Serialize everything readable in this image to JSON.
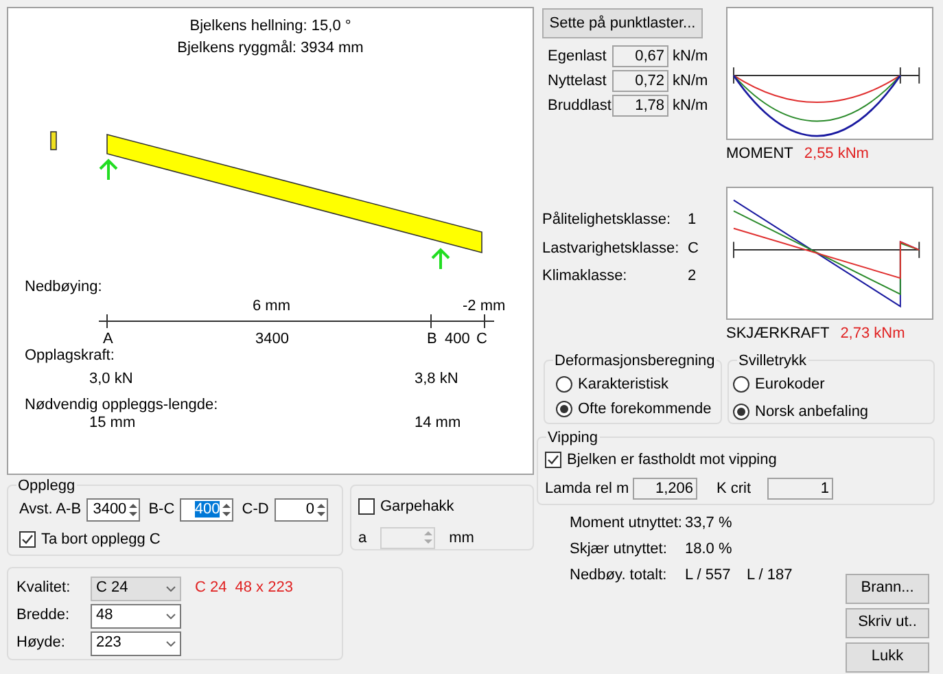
{
  "beam_view": {
    "slope": "Bjelkens hellning: 15,0 °",
    "ridge": "Bjelkens ryggmål: 3934 mm",
    "deflection_label": "Nedbøying:",
    "deflections": [
      "6 mm",
      "-2 mm"
    ],
    "supports": [
      "A",
      "B",
      "C"
    ],
    "spans": [
      "3400",
      "400"
    ],
    "reaction_label": "Opplagskraft:",
    "reactions": [
      "3,0 kN",
      "3,8 kN"
    ],
    "bearing_label": "Nødvendig oppleggs-lengde:",
    "bearing_lengths": [
      "15 mm",
      "14 mm"
    ]
  },
  "point_load_button": "Sette på punktlaster...",
  "loads": [
    {
      "label": "Egenlast",
      "value": "0,67",
      "unit": "kN/m"
    },
    {
      "label": "Nyttelast",
      "value": "0,72",
      "unit": "kN/m"
    },
    {
      "label": "Bruddlast",
      "value": "1,78",
      "unit": "kN/m"
    }
  ],
  "moment": {
    "label": "MOMENT",
    "value": "2,55 kNm"
  },
  "shear": {
    "label": "SKJÆRKRAFT",
    "value": "2,73 kNm"
  },
  "classes": [
    {
      "label": "Pålitelighetsklasse:",
      "value": "1"
    },
    {
      "label": "Lastvarighetsklasse:",
      "value": "C"
    },
    {
      "label": "Klimaklasse:",
      "value": "2"
    }
  ],
  "deformation": {
    "title": "Deformasjonsberegning",
    "options": [
      {
        "label": "Karakteristisk",
        "selected": false
      },
      {
        "label": "Ofte forekommende",
        "selected": true
      }
    ]
  },
  "sill": {
    "title": "Svilletrykk",
    "options": [
      {
        "label": "Eurokoder",
        "selected": false
      },
      {
        "label": "Norsk anbefaling",
        "selected": true
      }
    ]
  },
  "tipping": {
    "title": "Vipping",
    "checkbox": {
      "label": "Bjelken er fastholdt mot vipping",
      "checked": true
    },
    "lamda_label": "Lamda rel m",
    "lamda": "1,206",
    "kcrit_label": "K crit",
    "kcrit": "1"
  },
  "results": [
    {
      "label": "Moment utnyttet:",
      "values": [
        "33,7 %"
      ]
    },
    {
      "label": "Skjær  utnyttet:",
      "values": [
        "18.0 %"
      ]
    },
    {
      "label": "Nedbøy. totalt:",
      "values": [
        "L / 557",
        "L / 187"
      ]
    }
  ],
  "buttons": [
    "Brann...",
    "Skriv ut..",
    "Lukk"
  ],
  "supports_group": {
    "title": "Opplegg",
    "fields": [
      {
        "label": "Avst. A-B",
        "value": "3400",
        "selected": false
      },
      {
        "label": "B-C",
        "value": "400",
        "selected": true
      },
      {
        "label": "C-D",
        "value": "0",
        "selected": false
      }
    ],
    "remove": {
      "label": "Ta bort opplegg C",
      "checked": true
    }
  },
  "notch": {
    "label": "Garpehakk",
    "checked": false,
    "a_label": "a",
    "unit": "mm"
  },
  "timber": {
    "fields": [
      {
        "label": "Kvalitet:",
        "value": "C 24",
        "disabled": true
      },
      {
        "label": "Bredde:",
        "value": "48",
        "disabled": false
      },
      {
        "label": "Høyde:",
        "value": "223",
        "disabled": false
      }
    ],
    "summary": [
      "C 24",
      "48 x 223"
    ]
  }
}
